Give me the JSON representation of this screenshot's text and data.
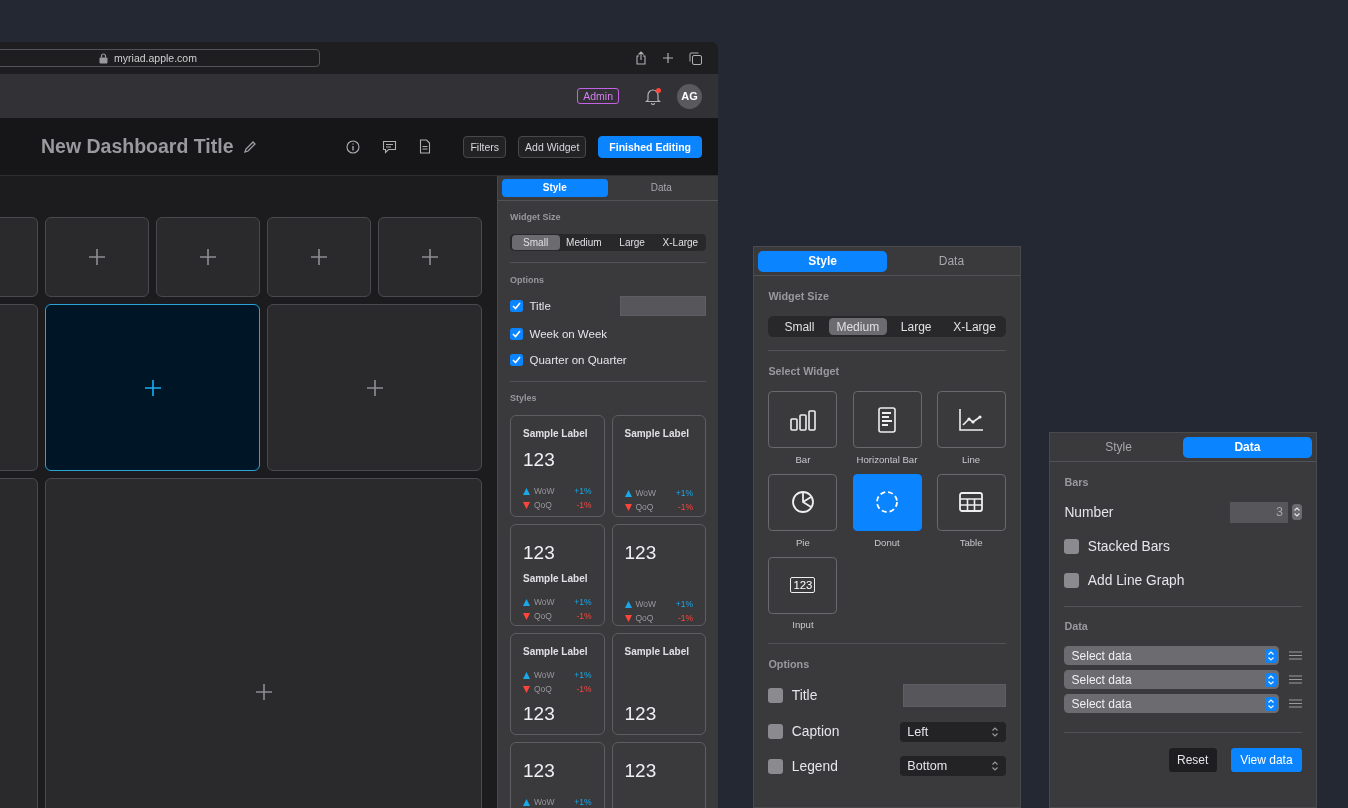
{
  "browser": {
    "url": "myriad.apple.com"
  },
  "header": {
    "badge": "Admin",
    "unread": true,
    "avatar": "AG"
  },
  "toolbar": {
    "title": "New Dashboard Title",
    "buttons": [
      {
        "label": "Filters",
        "kind": "secondary"
      },
      {
        "label": "Add Widget",
        "kind": "secondary"
      },
      {
        "label": "Finished Editing",
        "kind": "primary"
      }
    ]
  },
  "canvas": {
    "tiles": [
      {
        "kind": "small",
        "plus": false,
        "selected": false
      },
      {
        "kind": "small",
        "plus": true,
        "selected": false
      },
      {
        "kind": "small",
        "plus": true,
        "selected": false
      },
      {
        "kind": "small",
        "plus": true,
        "selected": false
      },
      {
        "kind": "small",
        "plus": true,
        "selected": false
      },
      {
        "kind": "column",
        "plus": false,
        "selected": false
      },
      {
        "kind": "medium",
        "plus": true,
        "selected": true
      },
      {
        "kind": "medium",
        "plus": true,
        "selected": false
      },
      {
        "kind": "large-column",
        "plus": false,
        "selected": false
      },
      {
        "kind": "large",
        "plus": true,
        "selected": false
      }
    ]
  },
  "editor_panel": {
    "tabs": [
      {
        "label": "Style",
        "selected": true
      },
      {
        "label": "Data",
        "selected": false
      }
    ],
    "sections": [
      {
        "kind": "size",
        "heading": "Widget Size",
        "options": [
          {
            "label": "Small",
            "selected": true
          },
          {
            "label": "Medium",
            "selected": false
          },
          {
            "label": "Large",
            "selected": false
          },
          {
            "label": "X-Large",
            "selected": false
          }
        ]
      },
      {
        "kind": "options",
        "heading": "Options",
        "rows": [
          {
            "kind": "checkbox-field",
            "label": "Title",
            "checked": true
          },
          {
            "kind": "checkbox",
            "label": "Week on Week",
            "checked": true
          },
          {
            "kind": "checkbox",
            "label": "Quarter on Quarter",
            "checked": true
          }
        ]
      },
      {
        "kind": "styles",
        "heading": "Styles",
        "cards": [
          {
            "parts": [
              {
                "kind": "label",
                "text": "Sample Label"
              },
              {
                "kind": "value",
                "text": "123"
              },
              {
                "kind": "metrics",
                "items": [
                  {
                    "name": "WoW",
                    "change": "+1%",
                    "kind": "up"
                  },
                  {
                    "name": "QoQ",
                    "change": "-1%",
                    "kind": "down"
                  }
                ]
              }
            ]
          },
          {
            "parts": [
              {
                "kind": "label",
                "text": "Sample Label"
              },
              {
                "kind": "blank"
              },
              {
                "kind": "metrics",
                "items": [
                  {
                    "name": "WoW",
                    "change": "+1%",
                    "kind": "up"
                  },
                  {
                    "name": "QoQ",
                    "change": "-1%",
                    "kind": "down"
                  }
                ]
              }
            ]
          },
          {
            "parts": [
              {
                "kind": "value",
                "text": "123"
              },
              {
                "kind": "label",
                "text": "Sample Label"
              },
              {
                "kind": "metrics",
                "items": [
                  {
                    "name": "WoW",
                    "change": "+1%",
                    "kind": "up"
                  },
                  {
                    "name": "QoQ",
                    "change": "-1%",
                    "kind": "down"
                  }
                ]
              }
            ]
          },
          {
            "parts": [
              {
                "kind": "value",
                "text": "123"
              },
              {
                "kind": "blank"
              },
              {
                "kind": "metrics",
                "items": [
                  {
                    "name": "WoW",
                    "change": "+1%",
                    "kind": "up"
                  },
                  {
                    "name": "QoQ",
                    "change": "-1%",
                    "kind": "down"
                  }
                ]
              }
            ]
          },
          {
            "parts": [
              {
                "kind": "label",
                "text": "Sample Label"
              },
              {
                "kind": "metrics",
                "items": [
                  {
                    "name": "WoW",
                    "change": "+1%",
                    "kind": "up"
                  },
                  {
                    "name": "QoQ",
                    "change": "-1%",
                    "kind": "down"
                  }
                ]
              },
              {
                "kind": "value",
                "text": "123"
              }
            ]
          },
          {
            "parts": [
              {
                "kind": "label",
                "text": "Sample Label"
              },
              {
                "kind": "blank"
              },
              {
                "kind": "value",
                "text": "123"
              }
            ]
          },
          {
            "parts": [
              {
                "kind": "value",
                "text": "123"
              },
              {
                "kind": "metrics",
                "items": [
                  {
                    "name": "WoW",
                    "change": "+1%",
                    "kind": "up"
                  }
                ]
              }
            ]
          },
          {
            "parts": [
              {
                "kind": "value",
                "text": "123"
              }
            ]
          }
        ]
      }
    ]
  },
  "floating_panels": [
    {
      "tabs": [
        {
          "label": "Style",
          "selected": true
        },
        {
          "label": "Data",
          "selected": false
        }
      ],
      "sections": [
        {
          "kind": "size",
          "heading": "Widget Size",
          "options": [
            {
              "label": "Small",
              "selected": false
            },
            {
              "label": "Medium",
              "selected": true
            },
            {
              "label": "Large",
              "selected": false
            },
            {
              "label": "X-Large",
              "selected": false
            }
          ]
        },
        {
          "kind": "widgets",
          "heading": "Select Widget",
          "items": [
            {
              "kind": "bar",
              "label": "Bar",
              "selected": false
            },
            {
              "kind": "hbar",
              "label": "Horizontal Bar",
              "selected": false
            },
            {
              "kind": "line",
              "label": "Line",
              "selected": false
            },
            {
              "kind": "pie",
              "label": "Pie",
              "selected": false
            },
            {
              "kind": "donut",
              "label": "Donut",
              "selected": true
            },
            {
              "kind": "table",
              "label": "Table",
              "selected": false
            },
            {
              "kind": "input",
              "label": "Input",
              "icon_text": "123",
              "selected": false
            }
          ]
        },
        {
          "kind": "options",
          "heading": "Options",
          "rows": [
            {
              "kind": "checkbox-field",
              "label": "Title",
              "checked": false
            },
            {
              "kind": "checkbox-select",
              "label": "Caption",
              "checked": false,
              "value": "Left"
            },
            {
              "kind": "checkbox-select",
              "label": "Legend",
              "checked": false,
              "value": "Bottom"
            }
          ]
        }
      ]
    },
    {
      "tabs": [
        {
          "label": "Style",
          "selected": false
        },
        {
          "label": "Data",
          "selected": true
        }
      ],
      "sections": [
        {
          "kind": "options",
          "heading": "Bars",
          "rows": [
            {
              "kind": "number",
              "label": "Number",
              "value": "3"
            },
            {
              "kind": "checkbox",
              "label": "Stacked Bars",
              "checked": false
            },
            {
              "kind": "checkbox",
              "label": "Add Line Graph",
              "checked": false
            }
          ]
        },
        {
          "kind": "data",
          "heading": "Data",
          "selects": [
            {
              "value": "Select data"
            },
            {
              "value": "Select data"
            },
            {
              "value": "Select data"
            }
          ]
        },
        {
          "kind": "actions",
          "buttons": [
            {
              "label": "Reset",
              "kind": "secondary"
            },
            {
              "label": "View data",
              "kind": "primary"
            }
          ]
        }
      ]
    }
  ]
}
